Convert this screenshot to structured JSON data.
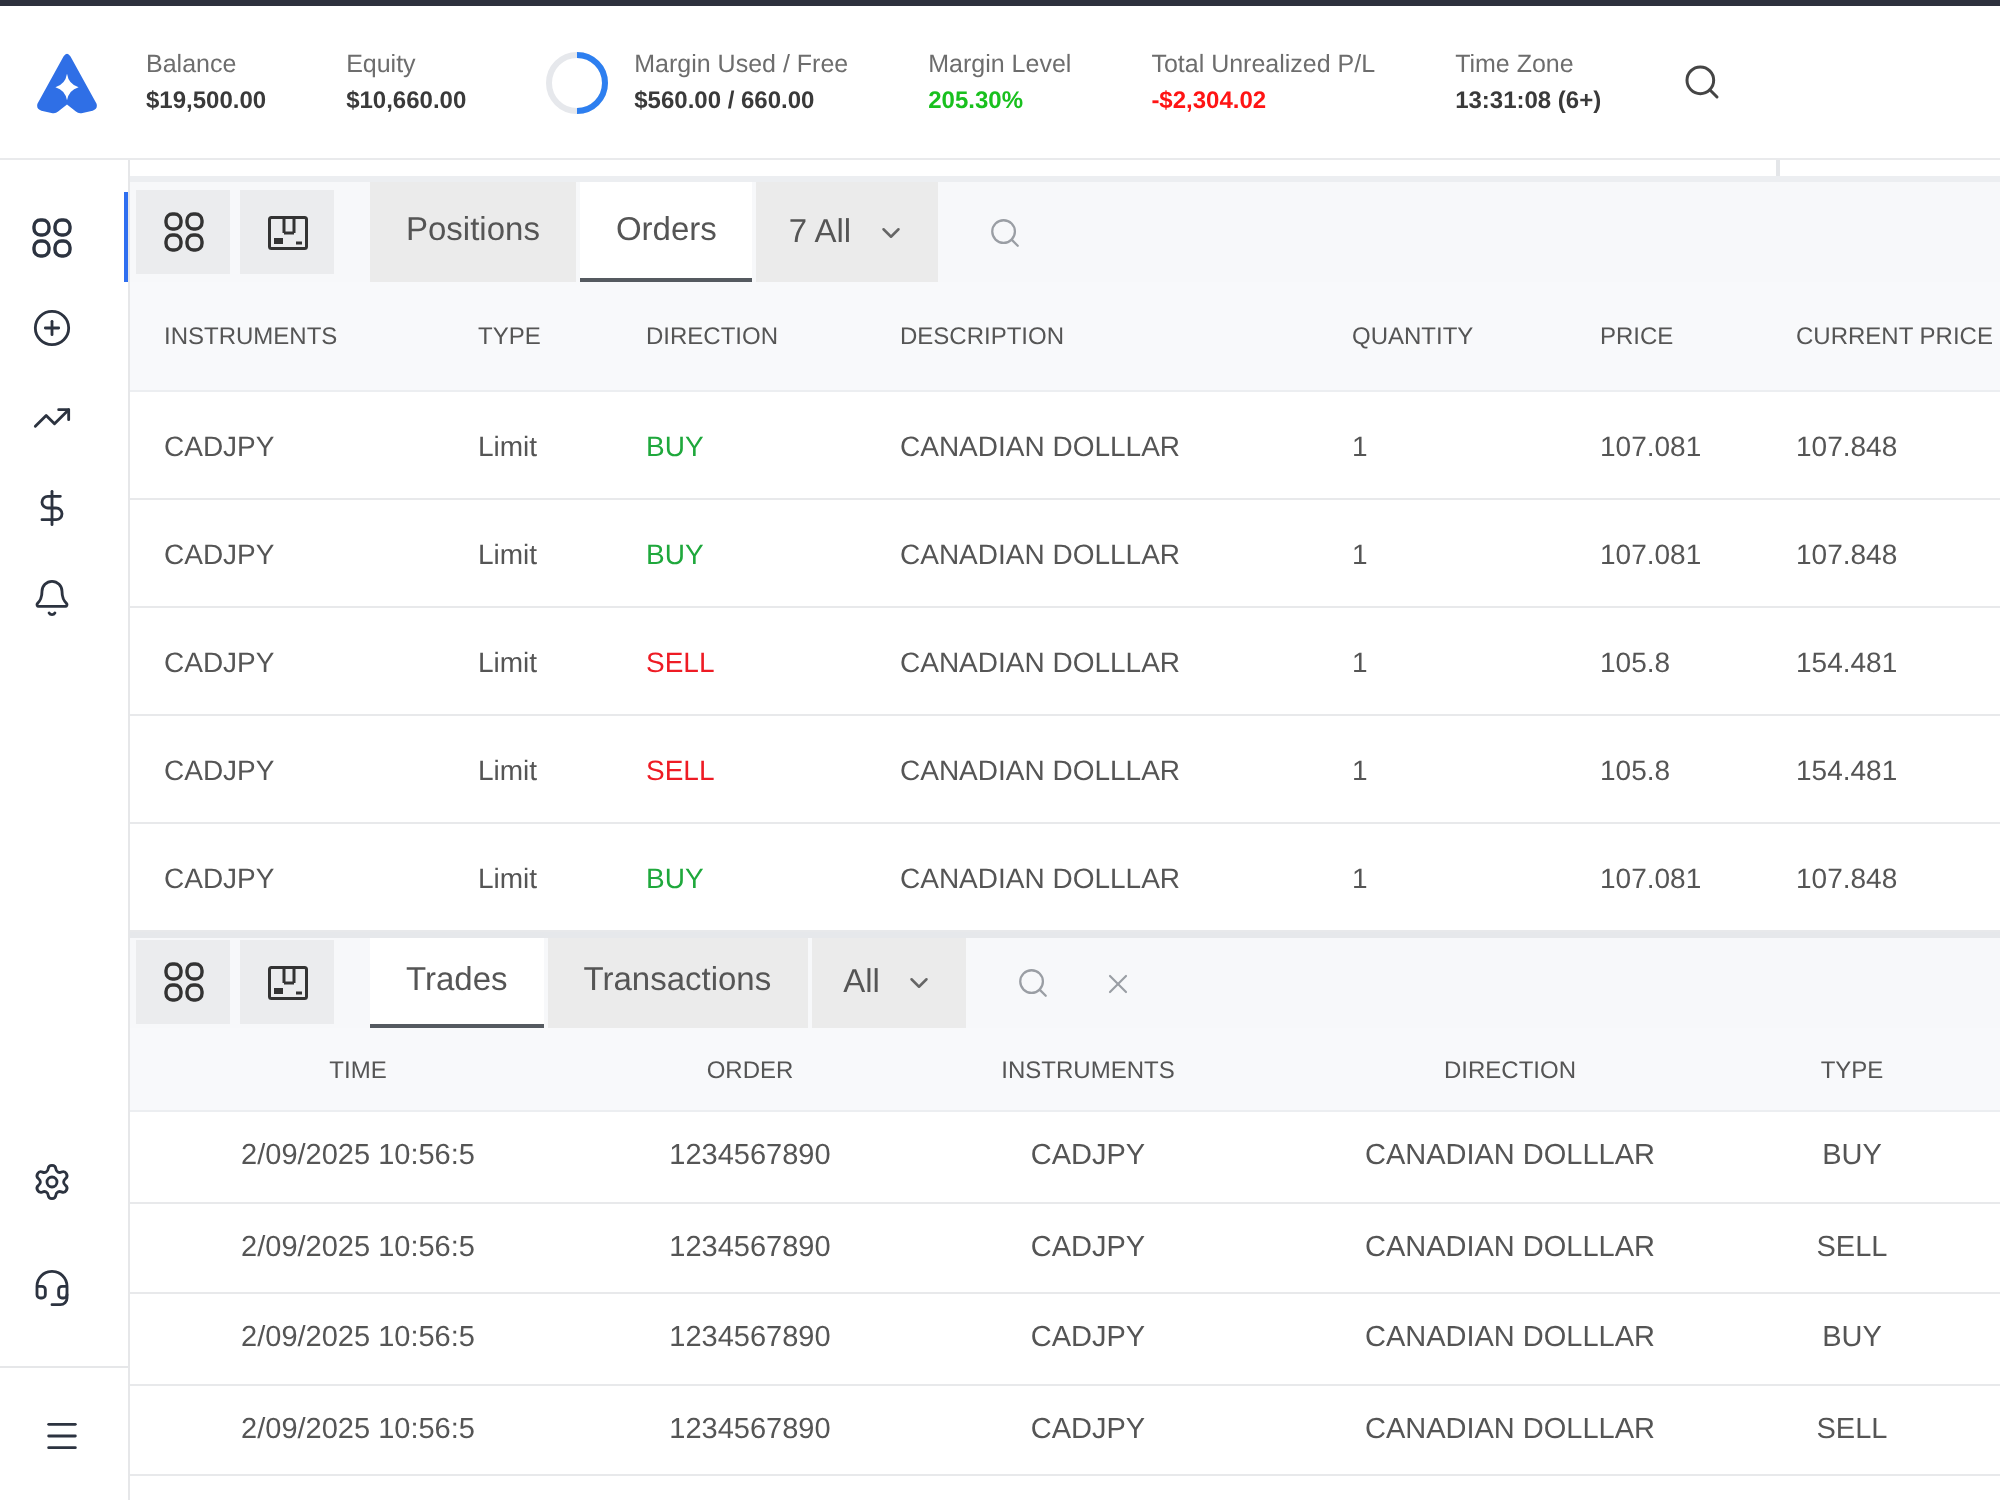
{
  "header": {
    "stats": [
      {
        "kind": "plain",
        "label": "Balance",
        "value": "$19,500.00",
        "color": "#3a3a3a"
      },
      {
        "kind": "plain",
        "label": "Equity",
        "value": "$10,660.00",
        "color": "#3a3a3a"
      },
      {
        "kind": "ring",
        "label": "Margin Used / Free",
        "value": "$560.00 / 660.00",
        "color": "#3a3a3a",
        "level": 0.5
      },
      {
        "kind": "plain",
        "label": "Margin Level",
        "value": "205.30%",
        "color": "#19c01e"
      },
      {
        "kind": "plain",
        "label": "Total Unrealized P/L",
        "value": "-$2,304.02",
        "color": "#ff1414"
      },
      {
        "kind": "plain",
        "label": "Time Zone",
        "value": "13:31:08 (6+)",
        "color": "#3a3a3a"
      }
    ]
  },
  "sidebar": {
    "items": [
      {
        "selected": true
      },
      {
        "selected": false
      },
      {
        "selected": false
      },
      {
        "selected": false
      },
      {
        "selected": false
      }
    ],
    "bottom_items": [
      {
        "selected": false
      },
      {
        "selected": false
      },
      {
        "selected": false
      }
    ]
  },
  "orders_panel": {
    "tabs": [
      {
        "label": "Positions",
        "selected": false
      },
      {
        "label": "Orders",
        "selected": true
      }
    ],
    "filter": "7 All",
    "table": {
      "columns": [
        "INSTRUMENTS",
        "TYPE",
        "DIRECTION",
        "DESCRIPTION",
        "QUANTITY",
        "PRICE",
        "CURRENT PRICE"
      ],
      "rows": [
        {
          "instrument": "CADJPY",
          "type": "Limit",
          "direction": {
            "label": "BUY",
            "color": "#1fa83c"
          },
          "description": "CANADIAN DOLLLAR",
          "quantity": "1",
          "price": "107.081",
          "current_price": "107.848"
        },
        {
          "instrument": "CADJPY",
          "type": "Limit",
          "direction": {
            "label": "BUY",
            "color": "#1fa83c"
          },
          "description": "CANADIAN DOLLLAR",
          "quantity": "1",
          "price": "107.081",
          "current_price": "107.848"
        },
        {
          "instrument": "CADJPY",
          "type": "Limit",
          "direction": {
            "label": "SELL",
            "color": "#ee1b24"
          },
          "description": "CANADIAN DOLLLAR",
          "quantity": "1",
          "price": "105.8",
          "current_price": "154.481"
        },
        {
          "instrument": "CADJPY",
          "type": "Limit",
          "direction": {
            "label": "SELL",
            "color": "#ee1b24"
          },
          "description": "CANADIAN DOLLLAR",
          "quantity": "1",
          "price": "105.8",
          "current_price": "154.481"
        },
        {
          "instrument": "CADJPY",
          "type": "Limit",
          "direction": {
            "label": "BUY",
            "color": "#1fa83c"
          },
          "description": "CANADIAN DOLLLAR",
          "quantity": "1",
          "price": "107.081",
          "current_price": "107.848"
        }
      ]
    }
  },
  "trades_panel": {
    "tabs": [
      {
        "label": "Trades",
        "selected": true
      },
      {
        "label": "Transactions",
        "selected": false
      }
    ],
    "filter": "All",
    "table": {
      "columns": [
        "TIME",
        "ORDER",
        "INSTRUMENTS",
        "DIRECTION",
        "TYPE"
      ],
      "rows": [
        {
          "time": "2/09/2025 10:56:5",
          "order": "1234567890",
          "instrument": "CADJPY",
          "direction": "CANADIAN DOLLLAR",
          "type": "BUY"
        },
        {
          "time": "2/09/2025 10:56:5",
          "order": "1234567890",
          "instrument": "CADJPY",
          "direction": "CANADIAN DOLLLAR",
          "type": "SELL"
        },
        {
          "time": "2/09/2025 10:56:5",
          "order": "1234567890",
          "instrument": "CADJPY",
          "direction": "CANADIAN DOLLLAR",
          "type": "BUY"
        },
        {
          "time": "2/09/2025 10:56:5",
          "order": "1234567890",
          "instrument": "CADJPY",
          "direction": "CANADIAN DOLLLAR",
          "type": "SELL"
        }
      ]
    }
  }
}
